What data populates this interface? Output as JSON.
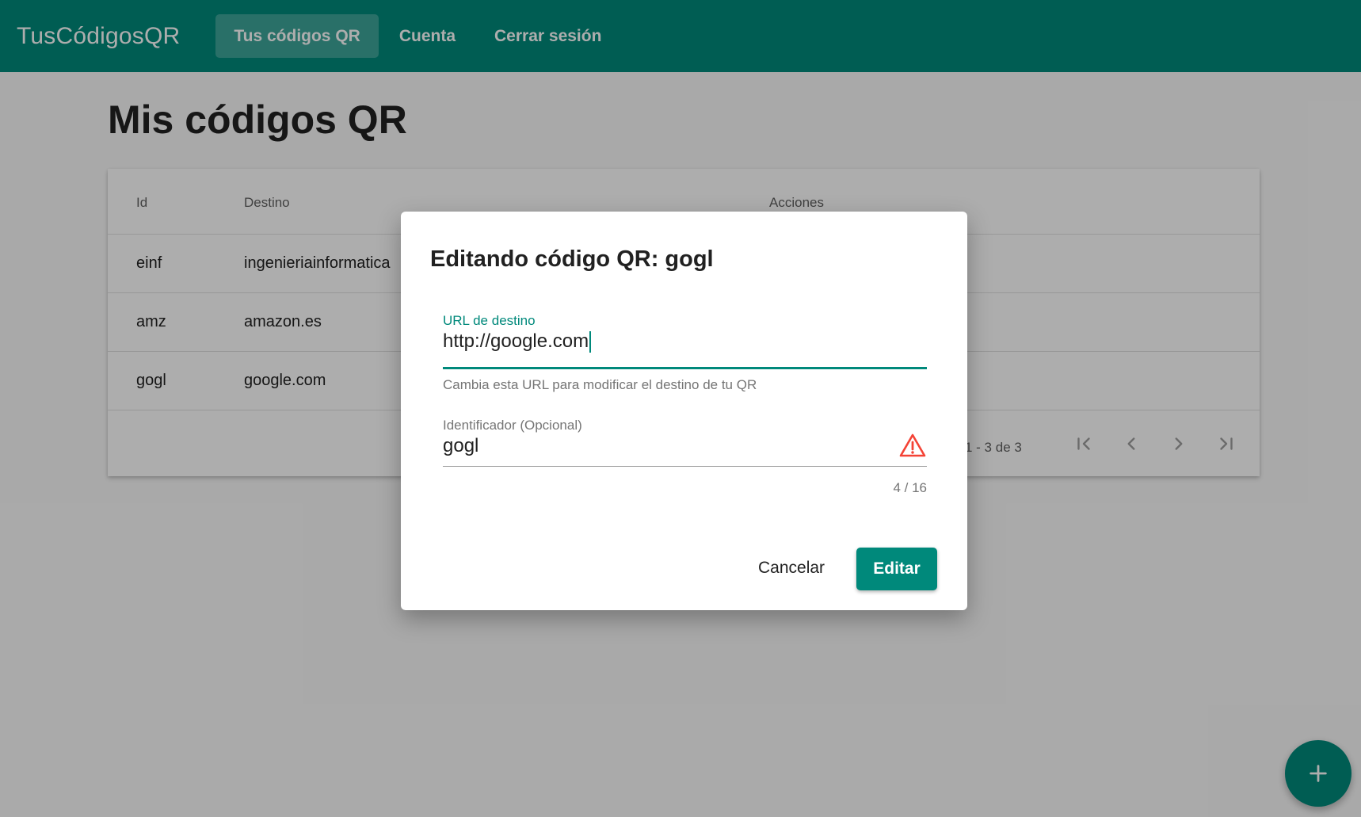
{
  "app": {
    "brand": "TusCódigosQR",
    "nav": [
      {
        "label": "Tus códigos QR",
        "active": true
      },
      {
        "label": "Cuenta",
        "active": false
      },
      {
        "label": "Cerrar sesión",
        "active": false
      }
    ]
  },
  "page": {
    "title": "Mis códigos QR"
  },
  "table": {
    "columns": [
      "Id",
      "Destino",
      "Acciones"
    ],
    "rows": [
      {
        "id": "einf",
        "destino": "ingenieriainformatica"
      },
      {
        "id": "amz",
        "destino": "amazon.es"
      },
      {
        "id": "gogl",
        "destino": "google.com"
      }
    ],
    "paginator": {
      "range": "1 - 3 de 3",
      "icons": [
        "first-page-icon",
        "previous-page-icon",
        "next-page-icon",
        "last-page-icon"
      ]
    }
  },
  "dialog": {
    "title": "Editando código QR: gogl",
    "url_field": {
      "label": "URL de destino",
      "value": "http://google.com",
      "hint": "Cambia esta URL para modificar el destino de tu QR"
    },
    "id_field": {
      "label": "Identificador (Opcional)",
      "value": "gogl",
      "counter": "4 / 16",
      "icon": "warning-icon"
    },
    "cancel_label": "Cancelar",
    "submit_label": "Editar"
  },
  "fab": {
    "icon": "add-icon"
  },
  "colors": {
    "primary": "#00897b",
    "warn": "#f44336",
    "overlay": "rgba(0,0,0,0.32)"
  }
}
